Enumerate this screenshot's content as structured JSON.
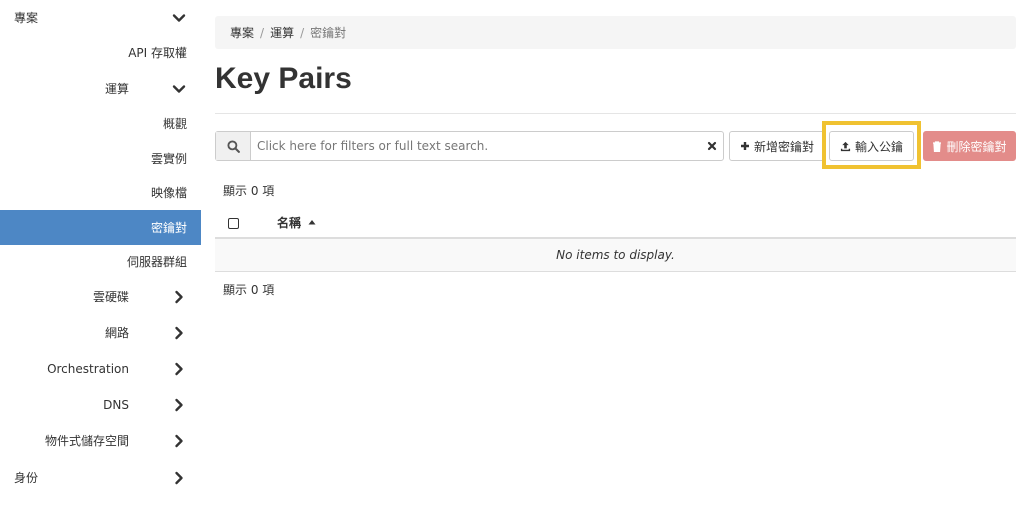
{
  "sidebar": {
    "items": [
      {
        "label": "專案",
        "chevron": "down"
      },
      {
        "label": "API 存取權"
      },
      {
        "label": "運算",
        "chevron": "down"
      },
      {
        "label": "概觀"
      },
      {
        "label": "雲實例"
      },
      {
        "label": "映像檔"
      },
      {
        "label": "密鑰對",
        "active": true
      },
      {
        "label": "伺服器群組"
      },
      {
        "label": "雲硬碟",
        "chevron": "right"
      },
      {
        "label": "網路",
        "chevron": "right"
      },
      {
        "label": "Orchestration",
        "chevron": "right"
      },
      {
        "label": "DNS",
        "chevron": "right"
      },
      {
        "label": "物件式儲存空間",
        "chevron": "right"
      },
      {
        "label": "身份",
        "chevron": "right"
      }
    ]
  },
  "breadcrumb": {
    "items": [
      "專案",
      "運算"
    ],
    "current": "密鑰對"
  },
  "page": {
    "title": "Key Pairs"
  },
  "search": {
    "placeholder": "Click here for filters or full text search."
  },
  "actions": {
    "create_label": "新增密鑰對",
    "import_label": "輸入公鑰",
    "delete_label": "刪除密鑰對"
  },
  "table": {
    "count_text": "顯示 0 項",
    "columns": [
      "名稱"
    ],
    "empty_text": "No items to display."
  },
  "colors": {
    "active": "#4d87c5",
    "highlight": "#f0c231",
    "danger": "#e38c8a"
  }
}
